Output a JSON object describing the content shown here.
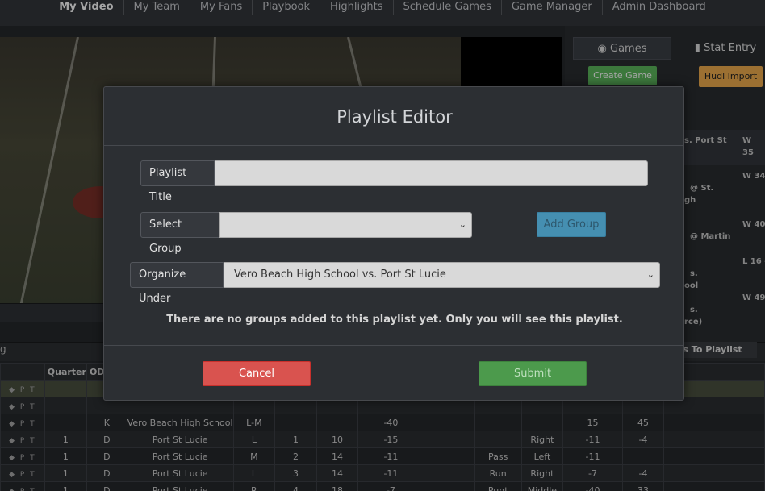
{
  "nav": {
    "items": [
      "My Video",
      "My Team",
      "My Fans",
      "Playbook",
      "Highlights",
      "Schedule Games",
      "Game Manager",
      "Admin Dashboard"
    ]
  },
  "side": {
    "tab_games": "Games",
    "tab_stat": "Stat Entry",
    "create_game": "Create Game",
    "hudl_import": "Hudl Import",
    "games": [
      {
        "name": "s. Port St",
        "result": "W 35"
      },
      {
        "name": "@ St.\ngh",
        "result": "W 34"
      },
      {
        "name": "@ Martin",
        "result": "W 40"
      },
      {
        "name": "s.\nool",
        "result": "L 16 -"
      },
      {
        "name": "s.\nrce)",
        "result": "W 49 -"
      }
    ],
    "clips_to_playlist": "lips To Playlist",
    "left_fragment": "g"
  },
  "table": {
    "headers": [
      "",
      "Quarter",
      "ODK"
    ],
    "rows": [
      {
        "quarter": "",
        "odk": "",
        "team": "",
        "hash": "",
        "down": "",
        "dist": "",
        "yard": "",
        "type": "",
        "dir": "",
        "gain": "",
        "eff": ""
      },
      {
        "quarter": "",
        "odk": "",
        "team": "",
        "hash": "",
        "down": "",
        "dist": "",
        "yard": "",
        "type": "",
        "dir": "",
        "gain": "",
        "eff": ""
      },
      {
        "quarter": "",
        "odk": "K",
        "team": "Vero Beach High School",
        "hash": "L-M",
        "down": "",
        "dist": "",
        "yard": "-40",
        "type": "",
        "dir": "",
        "gain": "15",
        "eff": "45"
      },
      {
        "quarter": "1",
        "odk": "D",
        "team": "Port St Lucie",
        "hash": "L",
        "down": "1",
        "dist": "10",
        "yard": "-15",
        "type": "",
        "dir": "Right",
        "gain": "-11",
        "eff": "-4"
      },
      {
        "quarter": "1",
        "odk": "D",
        "team": "Port St Lucie",
        "hash": "M",
        "down": "2",
        "dist": "14",
        "yard": "-11",
        "type": "Pass",
        "dir": "Left",
        "gain": "-11",
        "eff": ""
      },
      {
        "quarter": "1",
        "odk": "D",
        "team": "Port St Lucie",
        "hash": "L",
        "down": "3",
        "dist": "14",
        "yard": "-11",
        "type": "Run",
        "dir": "Right",
        "gain": "-7",
        "eff": "-4"
      },
      {
        "quarter": "1",
        "odk": "D",
        "team": "Port St Lucie",
        "hash": "R",
        "down": "4",
        "dist": "18",
        "yard": "-7",
        "type": "Punt",
        "dir": "Middle",
        "gain": "-40",
        "eff": "33"
      }
    ]
  },
  "modal": {
    "title": "Playlist Editor",
    "playlist_title_label": "Playlist Title",
    "playlist_title_value": "",
    "select_group_label": "Select Group",
    "select_group_value": "",
    "add_group": "Add Group",
    "organize_under_label": "Organize Under",
    "organize_under_value": "Vero Beach High School vs. Port St Lucie",
    "notice": "There are no groups added to this playlist yet. Only you will see this playlist.",
    "cancel": "Cancel",
    "submit": "Submit"
  }
}
